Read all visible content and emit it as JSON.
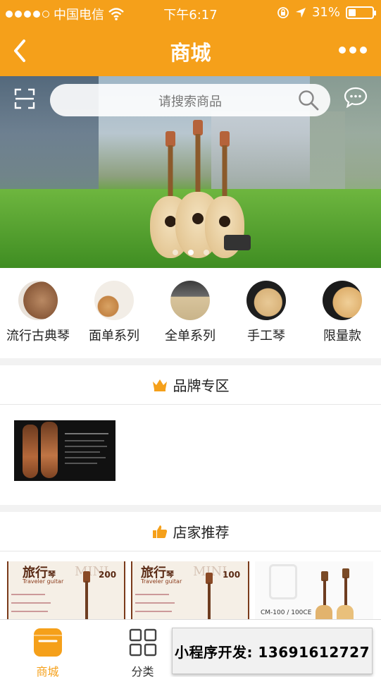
{
  "status_bar": {
    "carrier": "中国电信",
    "time": "下午6:17",
    "battery": "31%",
    "battery_level": 0.31
  },
  "nav": {
    "title": "商城"
  },
  "search": {
    "placeholder": "请搜索商品"
  },
  "banner": {
    "slide_count": 3,
    "active_slide": 2
  },
  "categories": [
    {
      "label": "流行古典琴",
      "icon": "guitar-icon"
    },
    {
      "label": "面单系列",
      "icon": "guitar-icon"
    },
    {
      "label": "全单系列",
      "icon": "guitar-bridge-icon"
    },
    {
      "label": "手工琴",
      "icon": "guitar-icon"
    },
    {
      "label": "限量款",
      "icon": "guitar-icon"
    }
  ],
  "brand": {
    "title": "品牌专区",
    "icon": "crown-icon"
  },
  "recommend": {
    "title": "店家推荐",
    "icon": "thumbs-up-icon",
    "items": [
      {
        "heading": "旅行",
        "heading2": "琴",
        "sub": "Traveler guitar",
        "mini": "MINI",
        "size": "200"
      },
      {
        "heading": "旅行",
        "heading2": "琴",
        "sub": "Traveler guitar",
        "mini": "MINI",
        "size": "100"
      },
      {
        "model": "CM-100 / 100CE"
      }
    ]
  },
  "tabs": [
    {
      "label": "商城",
      "icon": "store-icon",
      "active": true
    },
    {
      "label": "分类",
      "icon": "grid-icon",
      "active": false
    }
  ],
  "overlay": {
    "text": "小程序开发: 13691612727"
  },
  "colors": {
    "accent": "#f5a01a"
  }
}
